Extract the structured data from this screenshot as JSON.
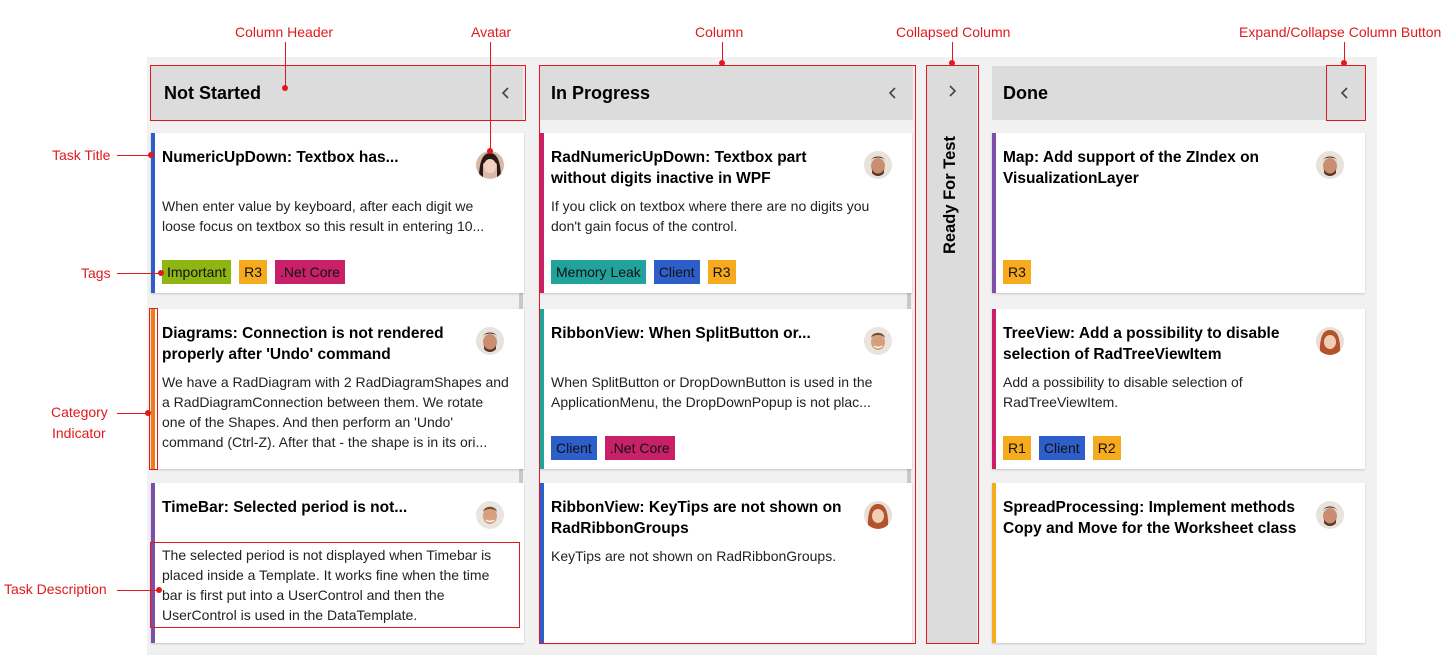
{
  "columns": [
    {
      "title": "Not Started",
      "cards": [
        {
          "title": "NumericUpDown: Textbox has...",
          "description": "When enter value by keyboard, after each digit we loose focus on textbox so this result in entering 10...",
          "category_color": "#2e5ec9",
          "avatar": "avatar-woman-dark-hair",
          "tags": [
            {
              "label": "Important",
              "color": "#8fb514"
            },
            {
              "label": "R3",
              "color": "#f5ab1d"
            },
            {
              "label": ".Net Core",
              "color": "#c8216a"
            }
          ]
        },
        {
          "title": "Diagrams: Connection is not rendered properly after 'Undo' command",
          "description": "We have a RadDiagram with 2 RadDiagramShapes and a RadDiagramConnection between them. We rotate one of the Shapes. And then perform an 'Undo' command (Ctrl-Z). After that - the shape is in its ori...",
          "category_color": "#f07c16",
          "avatar": "avatar-man-beard",
          "tags": []
        },
        {
          "title": "TimeBar: Selected period is not...",
          "description": "The selected period is not displayed when Timebar is placed inside a Template. It works fine when the time bar is first put into a UserControl and then the UserControl is used in the DataTemplate.",
          "category_color": "#7e4fa8",
          "avatar": "avatar-man-smiling",
          "tags": []
        }
      ]
    },
    {
      "title": "In Progress",
      "cards": [
        {
          "title": "RadNumericUpDown: Textbox part without digits inactive in WPF",
          "description": "If you click on textbox where there are no digits you don't gain focus of the control.",
          "category_color": "#c8216a",
          "avatar": "avatar-man-beard",
          "tags": [
            {
              "label": "Memory Leak",
              "color": "#21a39b"
            },
            {
              "label": "Client",
              "color": "#2e5ec9"
            },
            {
              "label": "R3",
              "color": "#f5ab1d"
            }
          ]
        },
        {
          "title": "RibbonView: When SplitButton or...",
          "description": "When SplitButton or DropDownButton is used in the ApplicationMenu, the DropDownPopup is not plac...",
          "category_color": "#21a39b",
          "avatar": "avatar-man-smiling",
          "tags": [
            {
              "label": "Client",
              "color": "#2e5ec9"
            },
            {
              "label": ".Net Core",
              "color": "#c8216a"
            }
          ]
        },
        {
          "title": "RibbonView: KeyTips are not shown on RadRibbonGroups",
          "description": "KeyTips are not shown on RadRibbonGroups.",
          "category_color": "#2e5ec9",
          "avatar": "avatar-woman-red-hair",
          "tags": []
        }
      ]
    },
    {
      "title": "Done",
      "cards": [
        {
          "title": "Map: Add support of the ZIndex on VisualizationLayer",
          "description": "",
          "category_color": "#7e4fa8",
          "avatar": "avatar-man-beard",
          "tags": [
            {
              "label": "R3",
              "color": "#f5ab1d"
            }
          ]
        },
        {
          "title": "TreeView: Add a possibility to disable selection of RadTreeViewItem",
          "description": "Add a possibility to disable selection of RadTreeViewItem.",
          "category_color": "#c8216a",
          "avatar": "avatar-woman-red-hair",
          "tags": [
            {
              "label": "R1",
              "color": "#f5ab1d"
            },
            {
              "label": "Client",
              "color": "#2e5ec9"
            },
            {
              "label": "R2",
              "color": "#f5ab1d"
            }
          ]
        },
        {
          "title": "SpreadProcessing: Implement methods Copy and Move for the Worksheet class",
          "description": "",
          "category_color": "#f5ab1d",
          "avatar": "avatar-man-beard",
          "tags": []
        }
      ]
    }
  ],
  "collapsed_column": {
    "title": "Ready For Test",
    "icon": "chevron-right-icon"
  },
  "annotations": {
    "column_header": "Column Header",
    "avatar": "Avatar",
    "column": "Column",
    "collapsed_column": "Collapsed Column",
    "expand_collapse": "Expand/Collapse Column Button",
    "task_title": "Task Title",
    "tags": "Tags",
    "category_indicator_1": "Category",
    "category_indicator_2": "Indicator",
    "task_description": "Task Description"
  },
  "colors": {
    "annotation": "#e0191e",
    "header": "#dcdcdc",
    "board": "#f1f1f1"
  }
}
